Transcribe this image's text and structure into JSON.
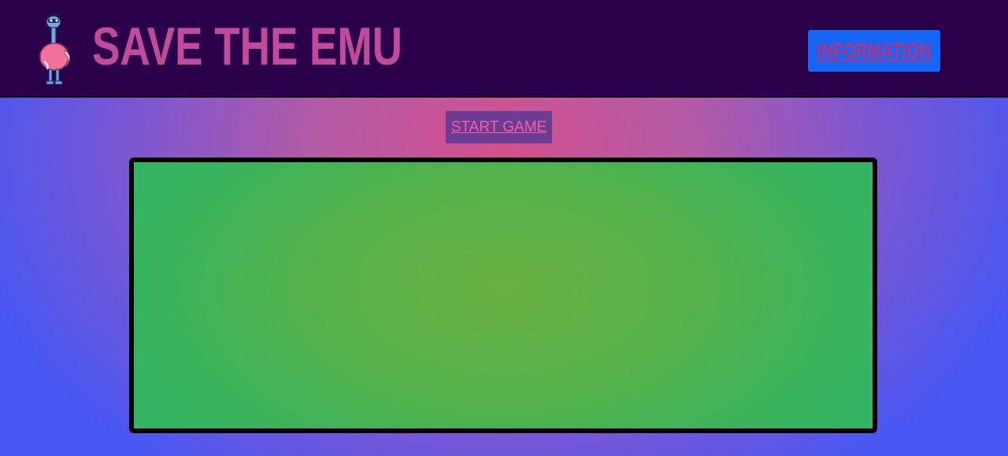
{
  "header": {
    "title": "SAVE THE EMU",
    "logo_icon": "emu-logo-icon",
    "info_button_label": "INFORMATION"
  },
  "main": {
    "start_button_label": "START GAME"
  },
  "colors": {
    "header_bg": "#2a004a",
    "title": "#c24a9a",
    "info_button_bg": "#1466f5",
    "info_button_text": "#b8307f",
    "start_button_bg": "#6a3d95",
    "start_button_text": "#ff5aa8",
    "board_green": "#4cb250",
    "board_border": "#000000"
  }
}
